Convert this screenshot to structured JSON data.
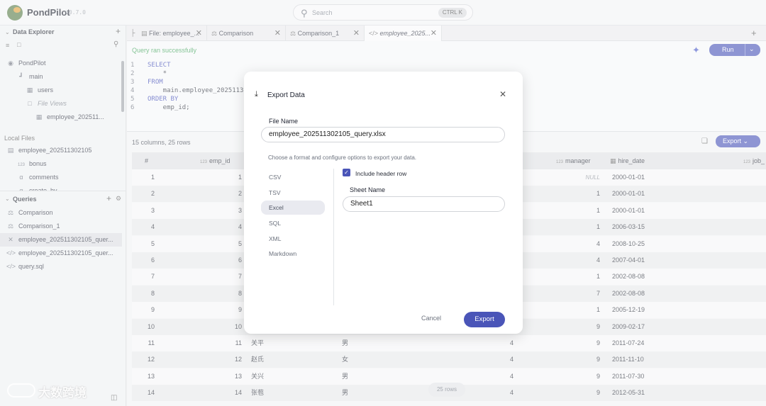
{
  "app": {
    "name": "PondPilot",
    "version": "v0.7.0"
  },
  "search": {
    "placeholder": "Search",
    "shortcut": "CTRL K"
  },
  "sidebar": {
    "data_explorer": {
      "title": "Data Explorer"
    },
    "tree": [
      {
        "label": "PondPilot",
        "icon": "database-icon"
      },
      {
        "label": "main",
        "icon": "schema-icon"
      },
      {
        "label": "users",
        "icon": "table-icon"
      },
      {
        "label": "File Views",
        "icon": "folder-icon"
      },
      {
        "label": "employee_202511...",
        "icon": "view-icon"
      }
    ],
    "local_files": {
      "title": "Local Files",
      "items": [
        {
          "label": "employee_202511302105",
          "icon": "file-icon"
        },
        {
          "label": "bonus",
          "icon": "column-icon"
        },
        {
          "label": "comments",
          "icon": "column-icon"
        },
        {
          "label": "create_by",
          "icon": "column-icon"
        }
      ]
    },
    "queries": {
      "title": "Queries",
      "items": [
        {
          "label": "Comparison",
          "icon": "comparison-icon"
        },
        {
          "label": "Comparison_1",
          "icon": "comparison-icon"
        },
        {
          "label": "employee_202511302105_quer...",
          "icon": "close-icon"
        },
        {
          "label": "employee_202511302105_quer...",
          "icon": "code-icon"
        },
        {
          "label": "query.sql",
          "icon": "code-icon"
        }
      ]
    }
  },
  "tabs": [
    {
      "label": "File: employee_...",
      "icon": "file-icon"
    },
    {
      "label": "Comparison",
      "icon": "comparison-icon"
    },
    {
      "label": "Comparison_1",
      "icon": "comparison-icon"
    },
    {
      "label": "employee_2025...",
      "icon": "code-icon"
    }
  ],
  "editor": {
    "status": "Query ran successfully",
    "run_label": "Run",
    "lines": [
      {
        "n": "1",
        "kw": "SELECT",
        "rest": ""
      },
      {
        "n": "2",
        "kw": "",
        "rest": "    *"
      },
      {
        "n": "3",
        "kw": "FROM",
        "rest": ""
      },
      {
        "n": "4",
        "kw": "",
        "rest": "    main.employee_2025113021"
      },
      {
        "n": "5",
        "kw": "ORDER BY",
        "rest": ""
      },
      {
        "n": "6",
        "kw": "",
        "rest": "    emp_id;"
      }
    ]
  },
  "results": {
    "meta": "15 columns, 25 rows",
    "export_label": "Export",
    "rows_pill": "25 rows",
    "headers": {
      "idx": "#",
      "emp_id": "emp_id",
      "manager": "manager",
      "hire_date": "hire_date",
      "job": "job_",
      "type_num": "123"
    },
    "rows": [
      {
        "idx": "1",
        "emp_id": "1",
        "name": "",
        "sex": "",
        "dept": "",
        "manager": "NULL",
        "hire_date": "2000-01-01"
      },
      {
        "idx": "2",
        "emp_id": "2",
        "name": "",
        "sex": "",
        "dept": "",
        "manager": "1",
        "hire_date": "2000-01-01"
      },
      {
        "idx": "3",
        "emp_id": "3",
        "name": "",
        "sex": "",
        "dept": "",
        "manager": "1",
        "hire_date": "2000-01-01"
      },
      {
        "idx": "4",
        "emp_id": "4",
        "name": "",
        "sex": "",
        "dept": "",
        "manager": "1",
        "hire_date": "2006-03-15"
      },
      {
        "idx": "5",
        "emp_id": "5",
        "name": "",
        "sex": "",
        "dept": "",
        "manager": "4",
        "hire_date": "2008-10-25"
      },
      {
        "idx": "6",
        "emp_id": "6",
        "name": "",
        "sex": "",
        "dept": "",
        "manager": "4",
        "hire_date": "2007-04-01"
      },
      {
        "idx": "7",
        "emp_id": "7",
        "name": "",
        "sex": "",
        "dept": "",
        "manager": "1",
        "hire_date": "2002-08-08"
      },
      {
        "idx": "8",
        "emp_id": "8",
        "name": "",
        "sex": "",
        "dept": "",
        "manager": "7",
        "hire_date": "2002-08-08"
      },
      {
        "idx": "9",
        "emp_id": "9",
        "name": "",
        "sex": "",
        "dept": "",
        "manager": "1",
        "hire_date": "2005-12-19"
      },
      {
        "idx": "10",
        "emp_id": "10",
        "name": "",
        "sex": "",
        "dept": "",
        "manager": "9",
        "hire_date": "2009-02-17"
      },
      {
        "idx": "11",
        "emp_id": "11",
        "name": "关平",
        "sex": "男",
        "dept": "4",
        "manager": "9",
        "hire_date": "2011-07-24"
      },
      {
        "idx": "12",
        "emp_id": "12",
        "name": "赵氏",
        "sex": "女",
        "dept": "4",
        "manager": "9",
        "hire_date": "2011-11-10"
      },
      {
        "idx": "13",
        "emp_id": "13",
        "name": "关兴",
        "sex": "男",
        "dept": "4",
        "manager": "9",
        "hire_date": "2011-07-30"
      },
      {
        "idx": "14",
        "emp_id": "14",
        "name": "张苞",
        "sex": "男",
        "dept": "4",
        "manager": "9",
        "hire_date": "2012-05-31"
      }
    ]
  },
  "modal": {
    "title": "Export Data",
    "file_name_label": "File Name",
    "file_name_value": "employee_202511302105_query.xlsx",
    "help": "Choose a format and configure options to export your data.",
    "formats": [
      "CSV",
      "TSV",
      "Excel",
      "SQL",
      "XML",
      "Markdown"
    ],
    "selected_format": "Excel",
    "include_header_label": "Include header row",
    "include_header_checked": true,
    "sheet_name_label": "Sheet Name",
    "sheet_name_value": "Sheet1",
    "cancel_label": "Cancel",
    "export_label": "Export"
  },
  "watermark": {
    "text": "大数跨境"
  },
  "colors": {
    "accent": "#4a55b8",
    "success": "#3aa055"
  }
}
